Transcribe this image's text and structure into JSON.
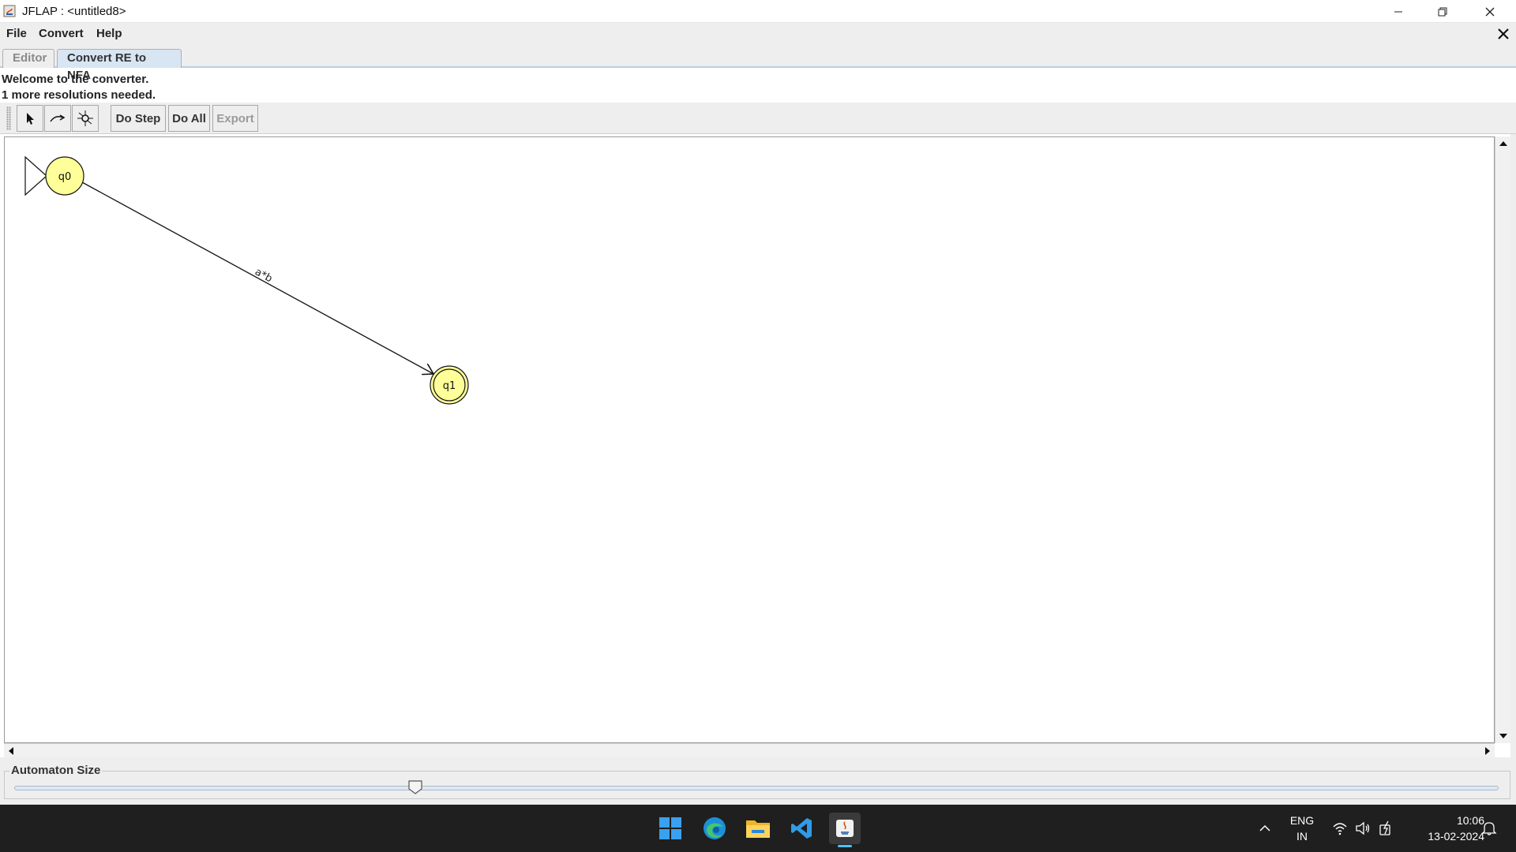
{
  "window": {
    "title": "JFLAP : <untitled8>"
  },
  "menu": {
    "items": [
      "File",
      "Convert",
      "Help"
    ]
  },
  "tabs": [
    {
      "label": "Editor",
      "active": false
    },
    {
      "label": "Convert RE to NFA",
      "active": true
    }
  ],
  "status": {
    "line1": "Welcome to the converter.",
    "line2": "1 more resolutions needed."
  },
  "toolbar": {
    "tools": [
      "pointer-tool-icon",
      "transition-tool-icon",
      "deexpressionify-tool-icon"
    ],
    "do_step_label": "Do Step",
    "do_all_label": "Do All",
    "export_label": "Export",
    "export_enabled": false
  },
  "automaton": {
    "states": [
      {
        "id": "q0",
        "label": "q0",
        "initial": true,
        "final": false
      },
      {
        "id": "q1",
        "label": "q1",
        "initial": false,
        "final": true
      }
    ],
    "transitions": [
      {
        "from": "q0",
        "to": "q1",
        "label": "a*b"
      }
    ],
    "state_fill": "#ffff99"
  },
  "size_panel": {
    "label": "Automaton Size",
    "level": 0.27
  },
  "taskbar": {
    "apps": [
      "windows-start-icon",
      "edge-browser-icon",
      "file-explorer-icon",
      "vscode-icon",
      "java-app-icon"
    ],
    "language_line1": "ENG",
    "language_line2": "IN",
    "time": "10:06",
    "date": "13-02-2024"
  }
}
